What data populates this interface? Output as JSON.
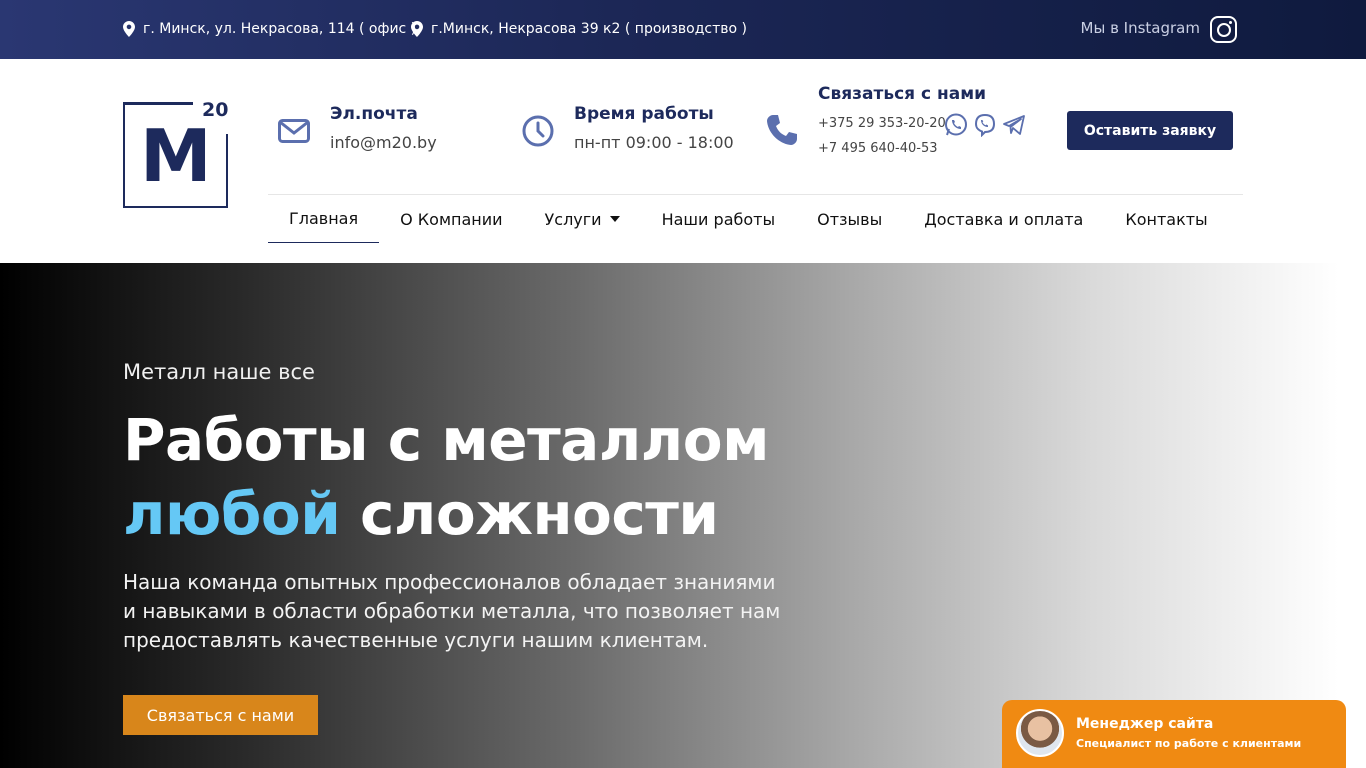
{
  "topbar": {
    "address_office": "г. Минск, ул. Некрасова, 114 ( офис )",
    "address_production": "г.Минск, Некрасова 39 к2 ( производство )",
    "instagram_label": "Мы в Instagram"
  },
  "logo": {
    "letter": "M",
    "number": "20"
  },
  "header": {
    "email_title": "Эл.почта",
    "email_value": "info@m20.by",
    "hours_title": "Время работы",
    "hours_value": "пн-пт 09:00 - 18:00",
    "contact_title": "Связаться с нами",
    "phone_1": "+375 29 353-20-20",
    "phone_2": "+7 495 640-40-53",
    "cta_label": "Оставить заявку"
  },
  "nav": {
    "items": [
      {
        "label": "Главная"
      },
      {
        "label": "О Компании"
      },
      {
        "label": "Услуги"
      },
      {
        "label": "Наши работы"
      },
      {
        "label": "Отзывы"
      },
      {
        "label": "Доставка и оплата"
      },
      {
        "label": "Контакты"
      }
    ]
  },
  "hero": {
    "kicker": "Металл наше все",
    "title_line1": "Работы с металлом",
    "title_accent": "любой",
    "title_rest": " сложности",
    "description": "Наша команда опытных профессионалов обладает знаниями и навыками в области обработки металла, что позволяет нам предоставлять качественные услуги нашим клиентам.",
    "cta_label": "Связаться с нами"
  },
  "chat": {
    "name": "Менеджер сайта",
    "role": "Специалист по работе с клиентами"
  },
  "colors": {
    "brand_navy": "#1d2a5c",
    "accent_blue": "#65c8f5",
    "cta_orange": "#d8861b",
    "chat_orange": "#f08a12"
  },
  "icons": [
    "map-pin-icon",
    "instagram-icon",
    "envelope-icon",
    "clock-icon",
    "phone-icon",
    "whatsapp-icon",
    "viber-icon",
    "telegram-icon",
    "chevron-down-icon"
  ]
}
